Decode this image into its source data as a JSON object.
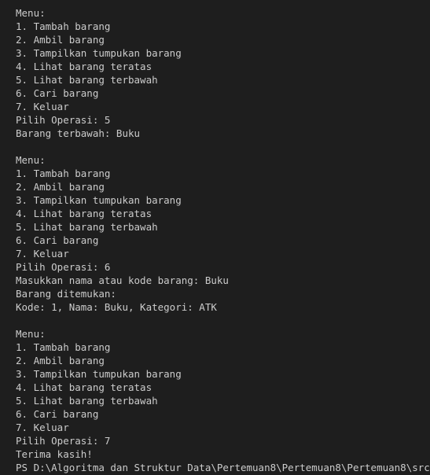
{
  "terminal": {
    "lines": [
      "Menu:",
      "1. Tambah barang",
      "2. Ambil barang",
      "3. Tampilkan tumpukan barang",
      "4. Lihat barang teratas",
      "5. Lihat barang terbawah",
      "6. Cari barang",
      "7. Keluar",
      "Pilih Operasi: 5",
      "Barang terbawah: Buku",
      "",
      "Menu:",
      "1. Tambah barang",
      "2. Ambil barang",
      "3. Tampilkan tumpukan barang",
      "4. Lihat barang teratas",
      "5. Lihat barang terbawah",
      "6. Cari barang",
      "7. Keluar",
      "Pilih Operasi: 6",
      "Masukkan nama atau kode barang: Buku",
      "Barang ditemukan:",
      "Kode: 1, Nama: Buku, Kategori: ATK",
      "",
      "Menu:",
      "1. Tambah barang",
      "2. Ambil barang",
      "3. Tampilkan tumpukan barang",
      "4. Lihat barang teratas",
      "5. Lihat barang terbawah",
      "6. Cari barang",
      "7. Keluar",
      "Pilih Operasi: 7",
      "Terima kasih!"
    ],
    "prompt": "PS D:\\Algoritma dan Struktur Data\\Pertemuan8\\Pertemuan8\\Pertemuan8\\src>"
  }
}
